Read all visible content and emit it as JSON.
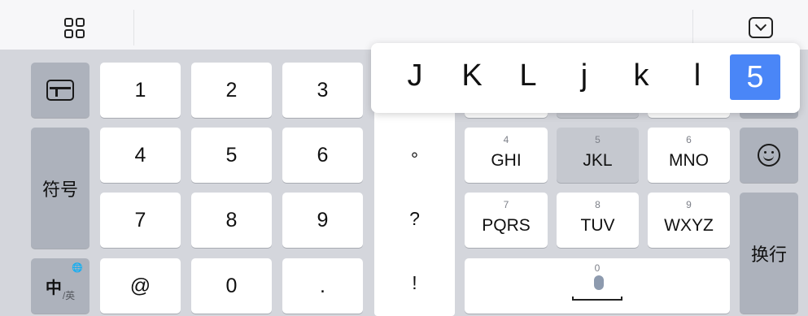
{
  "toolbar": {
    "grid_icon": "grid-icon",
    "collapse_icon": "keyboard-collapse-icon"
  },
  "candidates": [
    "J",
    "K",
    "L",
    "j",
    "k",
    "l",
    "5"
  ],
  "selected_candidate": "5",
  "numpad": {
    "row1": [
      "1",
      "2",
      "3"
    ],
    "row2": [
      "4",
      "5",
      "6"
    ],
    "row3": [
      "7",
      "8",
      "9"
    ],
    "row4": [
      "@",
      "0",
      "."
    ]
  },
  "left": {
    "symbols_label": "符号",
    "lang_main": "中",
    "lang_sub": "/英",
    "globe": "🌐"
  },
  "punct": [
    "°",
    "?",
    "!"
  ],
  "t9_row2": [
    {
      "num": "4",
      "letters": "GHI"
    },
    {
      "num": "5",
      "letters": "JKL"
    },
    {
      "num": "6",
      "letters": "MNO"
    }
  ],
  "t9_row3": [
    {
      "num": "7",
      "letters": "PQRS"
    },
    {
      "num": "8",
      "letters": "TUV"
    },
    {
      "num": "9",
      "letters": "WXYZ"
    }
  ],
  "space_hint": "0",
  "right": {
    "newline_label": "换行"
  },
  "colors": {
    "selected": "#4a86f7",
    "keyboard_bg": "#d4d6dc",
    "function_key": "#adb2bc"
  }
}
